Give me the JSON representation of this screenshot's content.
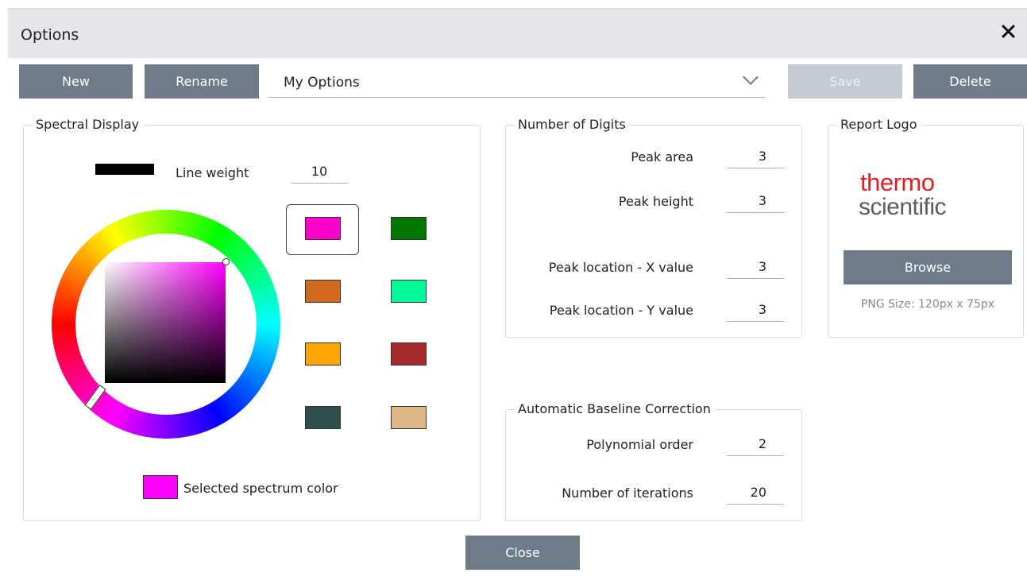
{
  "dialog": {
    "title": "Options"
  },
  "toolbar": {
    "new_label": "New",
    "rename_label": "Rename",
    "profile_value": "My Options",
    "save_label": "Save",
    "delete_label": "Delete"
  },
  "spectral_display": {
    "legend": "Spectral Display",
    "line_weight_label": "Line weight",
    "line_weight_value": "10",
    "selected_color_label": "Selected spectrum color",
    "selected_color": "#ff00ff",
    "colors": [
      "#ff00cc",
      "#007700",
      "#d2691e",
      "#00fa9a",
      "#ffa500",
      "#a52a2a",
      "#2f4f4f",
      "#deb887"
    ]
  },
  "digits": {
    "legend": "Number of Digits",
    "peak_area_label": "Peak area",
    "peak_area_value": "3",
    "peak_height_label": "Peak height",
    "peak_height_value": "3",
    "peak_x_label": "Peak location - X value",
    "peak_x_value": "3",
    "peak_y_label": "Peak location - Y value",
    "peak_y_value": "3"
  },
  "baseline": {
    "legend": "Automatic Baseline Correction",
    "poly_label": "Polynomial order",
    "poly_value": "2",
    "iter_label": "Number of iterations",
    "iter_value": "20"
  },
  "report_logo": {
    "legend": "Report Logo",
    "logo_line1": "thermo",
    "logo_line2": "scientific",
    "browse_label": "Browse",
    "size_hint": "PNG Size: 120px x 75px"
  },
  "footer": {
    "close_label": "Close"
  }
}
